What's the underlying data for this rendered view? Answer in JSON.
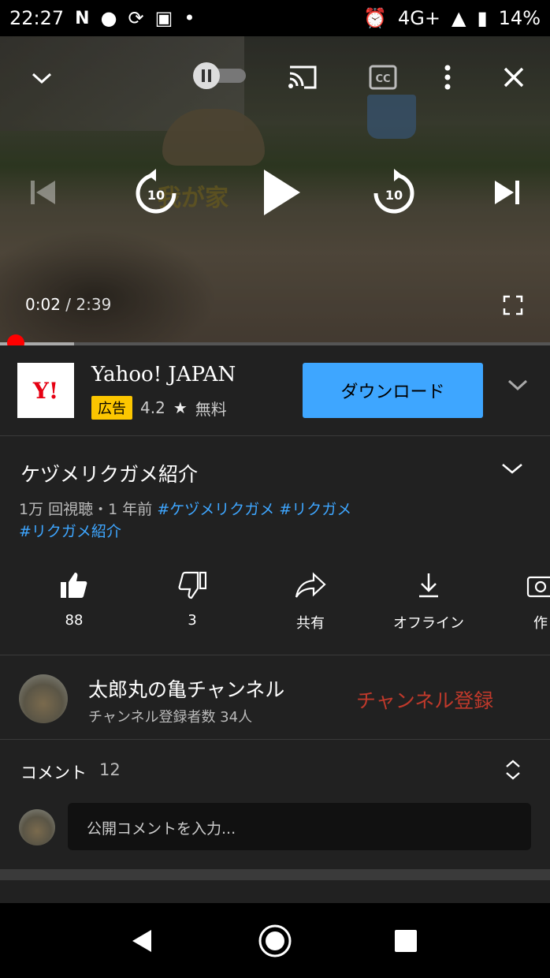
{
  "status_bar": {
    "time": "22:27",
    "left_icons": [
      "netflix-icon",
      "tinder-icon",
      "sync-icon",
      "app-icon",
      "dot"
    ],
    "network": "4G+",
    "battery": "14%"
  },
  "player": {
    "watermark": "我が家",
    "current_time": "0:02",
    "duration": "/ 2:39",
    "skip_back_seconds": "10",
    "skip_forward_seconds": "10",
    "progress_fraction": 0.013
  },
  "ad": {
    "logo_text": "Y!",
    "name": "Yahoo! JAPAN",
    "badge": "広告",
    "rating": "4.2",
    "price": "無料",
    "download_button": "ダウンロード"
  },
  "video": {
    "title": "ケヅメリクガメ紹介",
    "views": "1万 回視聴・1 年前",
    "hashtags_line1": [
      "#ケヅメリクガメ",
      "#リクガメ"
    ],
    "hashtags_line2": "#リクガメ紹介"
  },
  "actions": [
    {
      "label": "88",
      "icon": "thumbs-up-icon"
    },
    {
      "label": "3",
      "icon": "thumbs-down-icon"
    },
    {
      "label": "共有",
      "icon": "share-icon"
    },
    {
      "label": "オフライン",
      "icon": "download-icon"
    },
    {
      "label": "作",
      "icon": "create-icon"
    }
  ],
  "channel": {
    "name": "太郎丸の亀チャンネル",
    "subscribers": "チャンネル登録者数 34人",
    "subscribe_button": "チャンネル登録"
  },
  "comments": {
    "title": "コメント",
    "count": "12",
    "placeholder": "公開コメントを入力..."
  },
  "colors": {
    "accent_blue": "#3ea6ff",
    "progress_red": "#ff0000",
    "subscribe_red": "#c0392b",
    "ad_badge": "#fcc600"
  }
}
